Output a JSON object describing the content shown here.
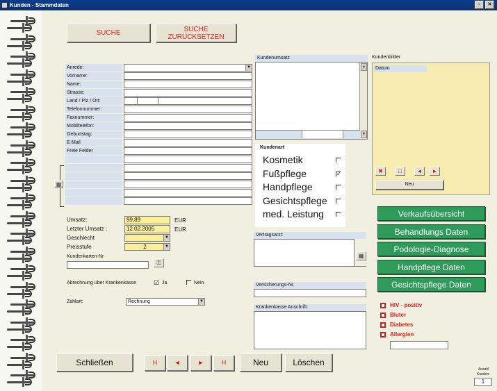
{
  "window": {
    "title": "Kunden - Stammdaten"
  },
  "search": {
    "search_label": "SUCHE",
    "reset_line1": "SUCHE",
    "reset_line2": "ZURÜCKSETZEN"
  },
  "fields": [
    {
      "label": "Anrede:"
    },
    {
      "label": "Vorname:"
    },
    {
      "label": "Name:"
    },
    {
      "label": "Strasse:"
    },
    {
      "label": "Land / Plz / Ort:"
    },
    {
      "label": "Telefonnummer:"
    },
    {
      "label": "Faxnummer:"
    },
    {
      "label": "Mobiltelefon:"
    },
    {
      "label": "Geburtstag:"
    },
    {
      "label": "E-Mail"
    },
    {
      "label": "Freie Felder"
    }
  ],
  "umsatz": {
    "umsatz_label": "Umsatz:",
    "umsatz_value": "99,89",
    "umsatz_unit": "EUR",
    "letzter_label": "Letzter Umsatz :",
    "letzter_value": "12.02.2005",
    "letzter_unit": "EUR",
    "geschlecht_label": "Geschlecht",
    "preisstufe_label": "Preisstufe",
    "preisstufe_value": "2",
    "kundenkarte_label": "Kundenkarten-Nr",
    "kasse_label": "Abrechnung über Krankenkasse",
    "ja_label": "Ja",
    "nein_label": "Nein",
    "ja_checked": "☑",
    "zahlart_label": "Zahlart:",
    "zahlart_value": "Rechnung"
  },
  "kundenumsatz": {
    "header": "Kundenumsatz"
  },
  "kundenart": {
    "header": "Kundenart",
    "items": [
      {
        "label": "Kosmetik",
        "checked": false
      },
      {
        "label": "Fußpflege",
        "checked": true
      },
      {
        "label": "Handpflege",
        "checked": false
      },
      {
        "label": "Gesichtspflege",
        "checked": false
      },
      {
        "label": "med. Leistung",
        "checked": false
      }
    ],
    "check_mark": "✓"
  },
  "vertragsarzt": {
    "header": "Vertragsarzt:"
  },
  "versicherung": {
    "header": "Versicherungs-Nr.",
    "kasse_header": "Krankenkasse Anschrift:"
  },
  "kundenbilder": {
    "header": "Kundenbilder",
    "datum_label": "Datum",
    "neu_label": "Neu"
  },
  "green_buttons": [
    "Verkaufsübersicht",
    "Behandlungs Daten",
    "Podologie-Diagnose",
    "Handpflege Daten",
    "Gesichtspflege Daten"
  ],
  "flags": [
    "HIV - positiv",
    "Bluter",
    "Diabetes",
    "Allergien"
  ],
  "footer": {
    "close_label": "Schließen",
    "nav_first": "H",
    "nav_prev": "◄",
    "nav_next": "►",
    "nav_last": "H",
    "neu_label": "Neu",
    "delete_label": "Löschen",
    "count_label1": "Anzahl",
    "count_label2": "Kunden:",
    "count_value": "1"
  },
  "colors": {
    "titlebar": "#0d2f70",
    "label_bg": "#d7e2ee",
    "yellow": "#fbef9a",
    "green_button": "#2e9b5a",
    "red_text": "#e0201c"
  }
}
